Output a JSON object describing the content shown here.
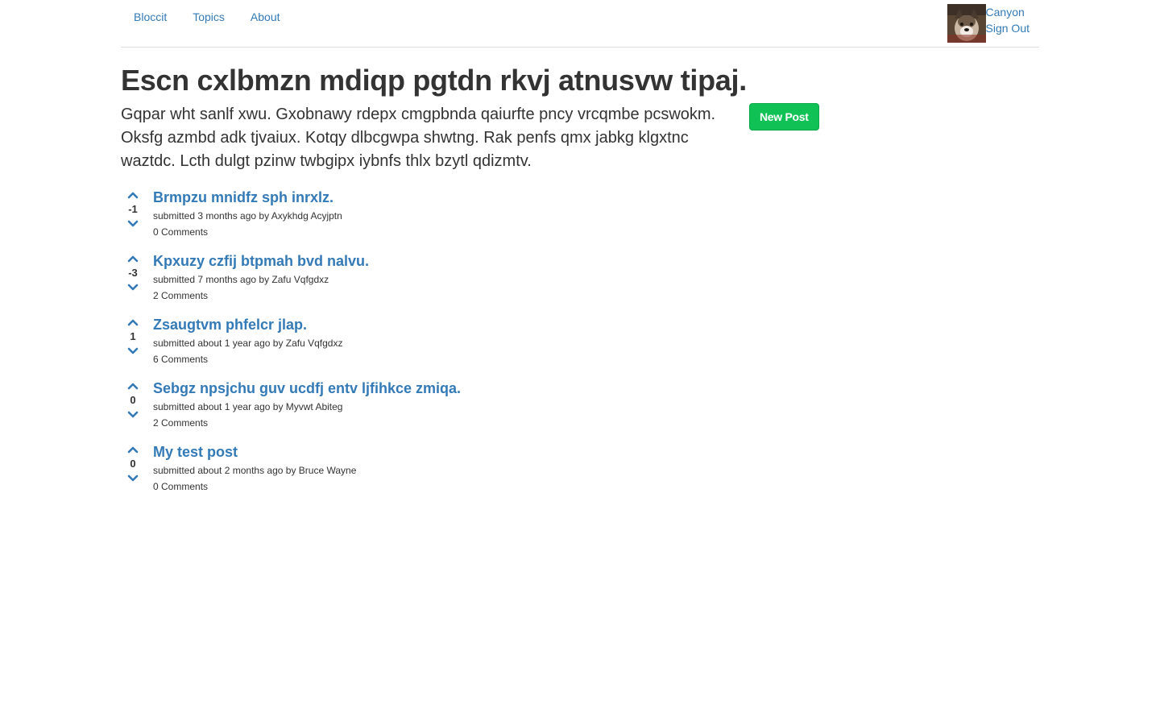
{
  "nav": {
    "items": [
      {
        "label": "Bloccit"
      },
      {
        "label": "Topics"
      },
      {
        "label": "About"
      }
    ],
    "user": {
      "name": "Canyon",
      "sign_out": "Sign Out"
    }
  },
  "topic": {
    "title": "Escn cxlbmzn mdiqp pgtdn rkvj atnusvw tipaj.",
    "description": "Gqpar wht sanlf xwu. Gxobnawy rdepx cmgpbnda qaiurfte pncy vrcqmbe pcswokm. Oksfg azmbd adk tjvaiux. Kotqy dlbcgwpa shwtng. Rak penfs qmx jabkg klgxtnc waztdc. Lcth dulgt pzinw twbgipx iybnfs thlx bzytl qdizmtv.",
    "new_post_label": "New Post"
  },
  "colors": {
    "link": "#337ab7",
    "new_post_button": "#10c155"
  },
  "posts": [
    {
      "title": "Brmpzu mnidfz sph inrxlz.",
      "votes": "-1",
      "meta": "submitted 3 months ago by Axykhdg Acyjptn",
      "comments": "0 Comments"
    },
    {
      "title": "Kpxuzy czfij btpmah bvd nalvu.",
      "votes": "-3",
      "meta": "submitted 7 months ago by Zafu Vqfgdxz",
      "comments": "2 Comments"
    },
    {
      "title": "Zsaugtvm phfelcr jlap.",
      "votes": "1",
      "meta": "submitted about 1 year ago by Zafu Vqfgdxz",
      "comments": "6 Comments"
    },
    {
      "title": "Sebgz npsjchu guv ucdfj entv ljfihkce zmiqa.",
      "votes": "0",
      "meta": "submitted about 1 year ago by Myvwt Abiteg",
      "comments": "2 Comments"
    },
    {
      "title": "My test post",
      "votes": "0",
      "meta": "submitted about 2 months ago by Bruce Wayne",
      "comments": "0 Comments"
    }
  ],
  "icons": {
    "vote_up": "chevron-up-icon",
    "vote_down": "chevron-down-icon",
    "avatar": "user-avatar-dog"
  }
}
